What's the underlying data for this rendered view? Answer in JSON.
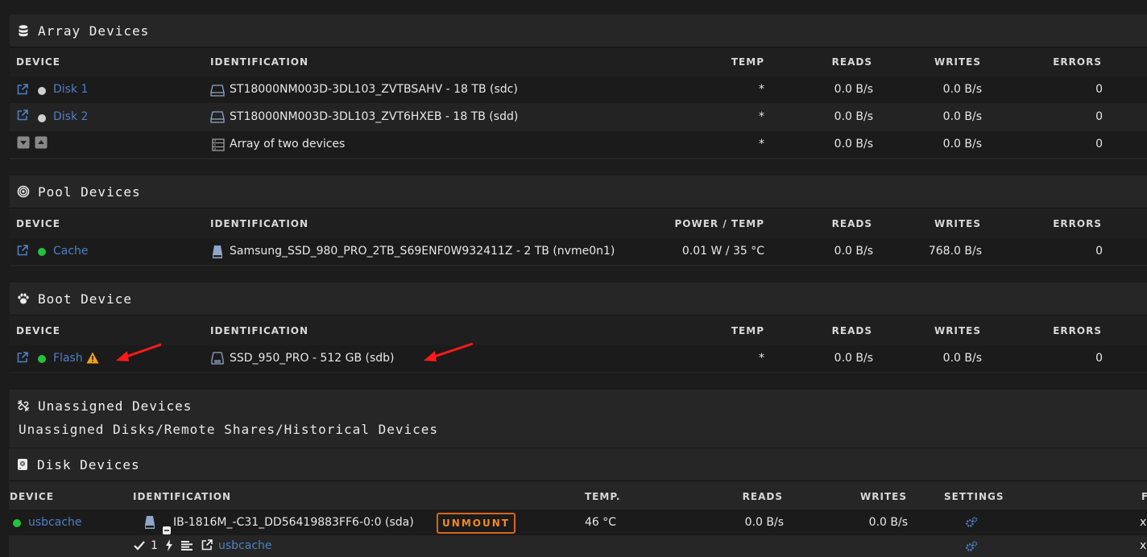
{
  "array": {
    "title": "Array Devices",
    "cols": {
      "device": "DEVICE",
      "ident": "IDENTIFICATION",
      "temp": "TEMP",
      "reads": "READS",
      "writes": "WRITES",
      "errors": "ERRORS"
    },
    "rows": [
      {
        "device": "Disk 1",
        "ident": "ST18000NM003D-3DL103_ZVTBSAHV - 18 TB (sdc)",
        "temp": "*",
        "reads": "0.0 B/s",
        "writes": "0.0 B/s",
        "errors": "0"
      },
      {
        "device": "Disk 2",
        "ident": "ST18000NM003D-3DL103_ZVT6HXEB - 18 TB (sdd)",
        "temp": "*",
        "reads": "0.0 B/s",
        "writes": "0.0 B/s",
        "errors": "0"
      },
      {
        "device": "",
        "ident": "Array of two devices",
        "temp": "*",
        "reads": "0.0 B/s",
        "writes": "0.0 B/s",
        "errors": "0"
      }
    ]
  },
  "pool": {
    "title": "Pool Devices",
    "cols": {
      "device": "DEVICE",
      "ident": "IDENTIFICATION",
      "temp": "POWER / TEMP",
      "reads": "READS",
      "writes": "WRITES",
      "errors": "ERRORS"
    },
    "rows": [
      {
        "device": "Cache",
        "ident": "Samsung_SSD_980_PRO_2TB_S69ENF0W932411Z - 2 TB (nvme0n1)",
        "temp": "0.01 W / 35 °C",
        "reads": "0.0 B/s",
        "writes": "768.0 B/s",
        "errors": "0"
      }
    ]
  },
  "boot": {
    "title": "Boot Device",
    "cols": {
      "device": "DEVICE",
      "ident": "IDENTIFICATION",
      "temp": "TEMP",
      "reads": "READS",
      "writes": "WRITES",
      "errors": "ERRORS"
    },
    "rows": [
      {
        "device": "Flash",
        "ident": "SSD_950_PRO - 512 GB (sdb)",
        "temp": "*",
        "reads": "0.0 B/s",
        "writes": "0.0 B/s",
        "errors": "0"
      }
    ]
  },
  "unassigned": {
    "title": "Unassigned Devices",
    "subtitle": "Unassigned Disks/Remote Shares/Historical Devices"
  },
  "disk": {
    "title": "Disk Devices",
    "cols": {
      "device": "DEVICE",
      "ident": "IDENTIFICATION",
      "temp": "TEMP.",
      "reads": "READS",
      "writes": "WRITES",
      "settings": "SETTINGS",
      "fs": "F"
    },
    "row": {
      "device": "usbcache",
      "ident": "IB-1816M_-C31_DD56419883FF6-0:0 (sda)",
      "button": "UNMOUNT",
      "temp": "46 °C",
      "reads": "0.0 B/s",
      "writes": "0.0 B/s",
      "fs": "x"
    },
    "partition": {
      "count": "1",
      "name": "usbcache",
      "fs": "x"
    }
  },
  "colors": {
    "accent": "#4f7fc6",
    "status_ok": "#23c23a",
    "warning": "#f2a21b",
    "unmount": "#d9661b",
    "annotation": "#ff1a1a"
  },
  "icons": [
    "database-icon",
    "pool-icon",
    "paw-icon",
    "unassigned-icon",
    "hdd-icon",
    "external-link-icon",
    "disk-icon",
    "warning-icon",
    "settings-icon"
  ]
}
